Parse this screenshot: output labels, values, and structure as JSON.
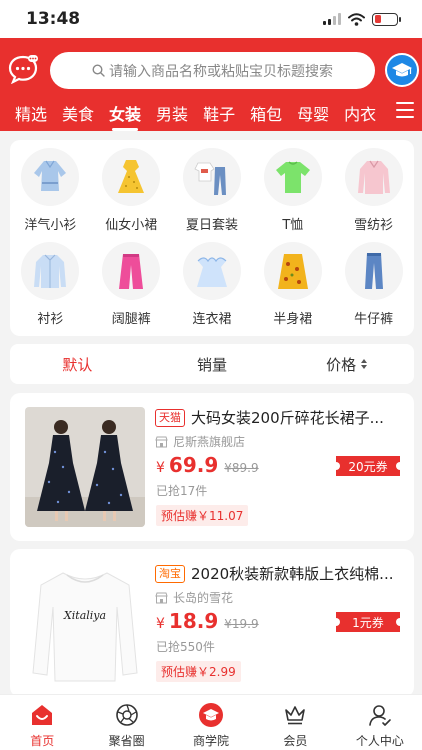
{
  "status_bar": {
    "time": "13:48"
  },
  "header": {
    "search_placeholder": "请输入商品名称或粘贴宝贝标题搜索",
    "categories": [
      {
        "label": "精选"
      },
      {
        "label": "美食"
      },
      {
        "label": "女装",
        "active": true
      },
      {
        "label": "男装"
      },
      {
        "label": "鞋子"
      },
      {
        "label": "箱包"
      },
      {
        "label": "母婴"
      },
      {
        "label": "内衣"
      }
    ]
  },
  "subcategories": [
    {
      "label": "洋气小衫",
      "icon": "blouse-icon"
    },
    {
      "label": "仙女小裙",
      "icon": "yellow-dress-icon"
    },
    {
      "label": "夏日套装",
      "icon": "summer-set-icon"
    },
    {
      "label": "T恤",
      "icon": "tshirt-icon"
    },
    {
      "label": "雪纺衫",
      "icon": "chiffon-shirt-icon"
    },
    {
      "label": "衬衫",
      "icon": "shirt-icon"
    },
    {
      "label": "阔腿裤",
      "icon": "wide-pants-icon"
    },
    {
      "label": "连衣裙",
      "icon": "dress-icon"
    },
    {
      "label": "半身裙",
      "icon": "skirt-icon"
    },
    {
      "label": "牛仔裤",
      "icon": "jeans-icon"
    }
  ],
  "sort": {
    "default_label": "默认",
    "sales_label": "销量",
    "price_label": "价格"
  },
  "products": [
    {
      "platform": "天猫",
      "title": "大码女装200斤碎花长裙子...",
      "shop": "尼斯燕旗舰店",
      "yen": "¥",
      "price": "69.9",
      "original_price": "¥89.9",
      "sold": "已抢17件",
      "estimated_earn": "预估赚￥11.07",
      "coupon": "20元券"
    },
    {
      "platform": "淘宝",
      "title": "2020秋装新款韩版上衣纯棉...",
      "shop": "长岛的雪花",
      "yen": "¥",
      "price": "18.9",
      "original_price": "¥19.9",
      "sold": "已抢550件",
      "estimated_earn": "预估赚￥2.99",
      "coupon": "1元券",
      "shirt_text": "Xitaliya"
    }
  ],
  "tabbar": [
    {
      "label": "首页",
      "icon": "home-icon",
      "active": true
    },
    {
      "label": "聚省圈",
      "icon": "aperture-icon"
    },
    {
      "label": "商学院",
      "icon": "academy-icon"
    },
    {
      "label": "会员",
      "icon": "crown-icon"
    },
    {
      "label": "个人中心",
      "icon": "user-icon"
    }
  ],
  "colors": {
    "accent": "#e8302e",
    "taobao": "#ff6a00",
    "edu_blue": "#1e88e5"
  }
}
